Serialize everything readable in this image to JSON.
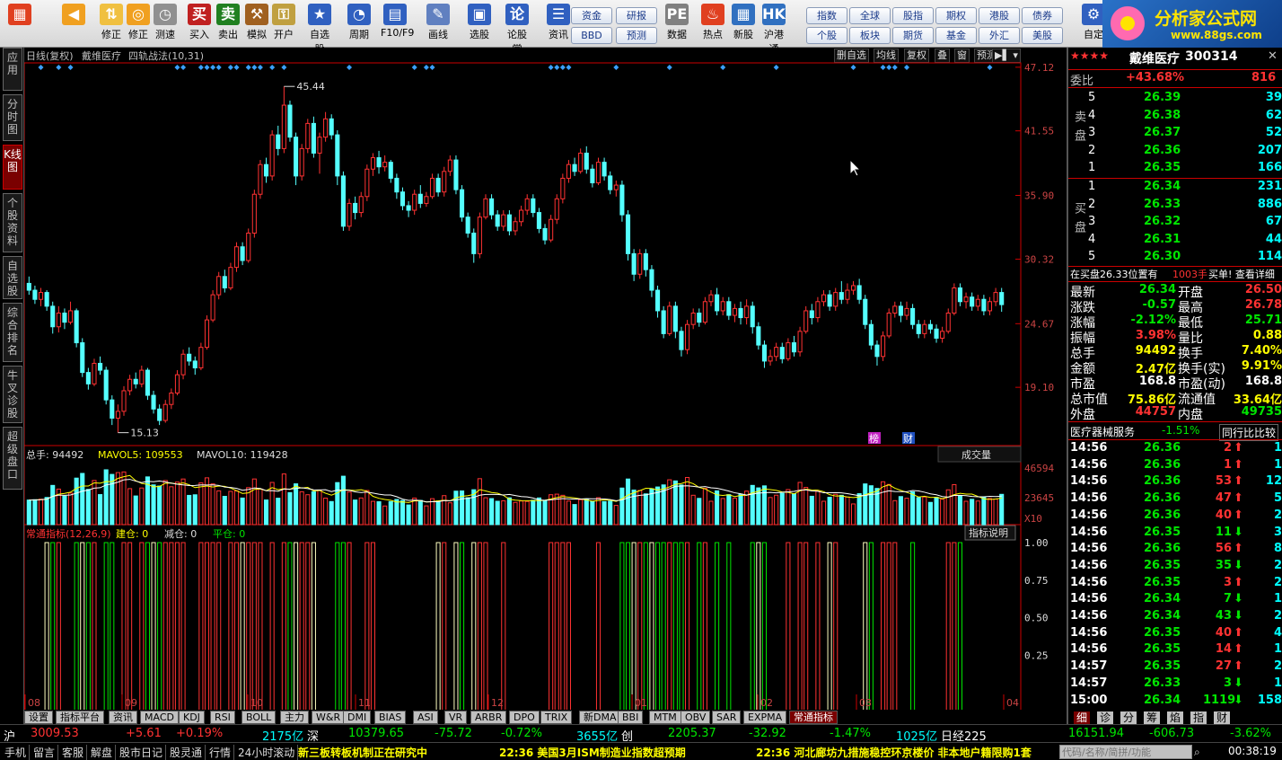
{
  "toolbar": {
    "buttons": [
      {
        "label": "",
        "icon": "grid-icon"
      },
      {
        "label": "",
        "icon": "back-arrow-icon"
      },
      {
        "label": "修正",
        "icon": "up-down-icon"
      },
      {
        "label": "修正",
        "icon": "refresh-icon"
      },
      {
        "label": "测速",
        "icon": "clock-icon"
      },
      {
        "label": "买入",
        "icon": "buy-icon"
      },
      {
        "label": "卖出",
        "icon": "sell-icon"
      },
      {
        "label": "模拟",
        "icon": "hammer-icon"
      },
      {
        "label": "开户",
        "icon": "lock-icon"
      },
      {
        "label": "自选股",
        "icon": "star-icon"
      },
      {
        "label": "周期",
        "icon": "period-icon"
      },
      {
        "label": "F10/F9",
        "icon": "f10-icon"
      },
      {
        "label": "画线",
        "icon": "pen-icon"
      },
      {
        "label": "选股",
        "icon": "select-icon"
      },
      {
        "label": "论股堂",
        "icon": "forum-icon"
      },
      {
        "label": "资讯",
        "icon": "news-icon"
      },
      {
        "label": "数据",
        "icon": "pe-icon"
      },
      {
        "label": "热点",
        "icon": "hot-icon"
      },
      {
        "label": "新股",
        "icon": "newstock-icon"
      },
      {
        "label": "沪港通",
        "icon": "hk-icon"
      },
      {
        "label": "自定",
        "icon": "custom-icon"
      }
    ],
    "small": [
      [
        "资金",
        "BBD"
      ],
      [
        "研报",
        "预测"
      ],
      [
        "指数",
        "个股"
      ],
      [
        "全球",
        "板块"
      ],
      [
        "股指",
        "期货"
      ],
      [
        "期权",
        "基金"
      ],
      [
        "港股",
        "外汇"
      ],
      [
        "债券",
        "美股"
      ]
    ],
    "logo_title": "分析家公式网",
    "logo_url": "www.88gs.com"
  },
  "left_tabs": [
    "应用",
    "分时图",
    "K线图",
    "个股资料",
    "自选股",
    "综合排名",
    "牛叉诊股",
    "超级盘口"
  ],
  "chart_header": {
    "title": "日线(复权)",
    "stock": "戴维医疗",
    "indicator": "四轨战法(10,31)",
    "tools": [
      "删自选",
      "均线",
      "复权",
      "叠",
      "窗",
      "预测"
    ]
  },
  "chart_data": {
    "type": "candlestick",
    "y_ticks": [
      "47.12",
      "41.55",
      "35.90",
      "30.32",
      "24.67",
      "19.10"
    ],
    "ylim": [
      14.0,
      47.5
    ],
    "x_ticks": [
      "08",
      "09",
      "10",
      "11",
      "12",
      "01",
      "02",
      "03",
      "04"
    ],
    "high_label": "45.44",
    "low_label": "15.13",
    "candles": [
      [
        28.2,
        27.6,
        28.8,
        27.2
      ],
      [
        27.6,
        26.8,
        28.0,
        26.4
      ],
      [
        26.8,
        27.4,
        27.8,
        26.2
      ],
      [
        27.4,
        26.2,
        27.6,
        25.8
      ],
      [
        26.2,
        24.4,
        26.6,
        23.8
      ],
      [
        24.4,
        25.6,
        26.2,
        23.9
      ],
      [
        25.6,
        24.8,
        26.0,
        24.2
      ],
      [
        24.8,
        25.8,
        26.6,
        24.6
      ],
      [
        25.8,
        23.0,
        26.0,
        22.6
      ],
      [
        23.0,
        20.4,
        23.4,
        20.0
      ],
      [
        20.4,
        19.4,
        20.8,
        18.9
      ],
      [
        19.4,
        21.2,
        21.6,
        19.2
      ],
      [
        21.2,
        20.6,
        21.8,
        20.2
      ],
      [
        20.6,
        18.0,
        20.9,
        17.6
      ],
      [
        18.0,
        16.4,
        18.4,
        15.8
      ],
      [
        16.4,
        17.0,
        17.6,
        15.13
      ],
      [
        17.0,
        18.8,
        19.2,
        16.6
      ],
      [
        18.8,
        19.8,
        20.2,
        18.4
      ],
      [
        19.8,
        19.4,
        20.4,
        19.0
      ],
      [
        19.4,
        20.6,
        21.0,
        19.1
      ],
      [
        20.6,
        18.4,
        20.8,
        18.0
      ],
      [
        18.4,
        17.2,
        18.8,
        16.8
      ],
      [
        17.2,
        16.2,
        17.6,
        15.8
      ],
      [
        16.2,
        17.6,
        18.0,
        16.0
      ],
      [
        17.6,
        18.6,
        19.0,
        17.2
      ],
      [
        18.6,
        20.2,
        20.6,
        18.4
      ],
      [
        20.2,
        22.0,
        22.4,
        19.8
      ],
      [
        22.0,
        21.4,
        22.6,
        21.0
      ],
      [
        21.4,
        20.8,
        21.8,
        20.2
      ],
      [
        20.8,
        22.6,
        23.0,
        20.6
      ],
      [
        22.6,
        25.0,
        25.4,
        22.4
      ],
      [
        25.0,
        27.2,
        27.6,
        24.8
      ],
      [
        27.2,
        28.8,
        29.2,
        26.8
      ],
      [
        28.8,
        27.8,
        29.4,
        27.4
      ],
      [
        27.8,
        29.6,
        30.0,
        27.6
      ],
      [
        29.6,
        31.4,
        31.8,
        29.2
      ],
      [
        31.4,
        30.2,
        31.8,
        29.8
      ],
      [
        30.2,
        32.6,
        33.0,
        30.0
      ],
      [
        32.6,
        36.0,
        36.4,
        32.2
      ],
      [
        36.0,
        38.6,
        39.0,
        35.6
      ],
      [
        38.6,
        37.6,
        39.2,
        37.0
      ],
      [
        37.6,
        41.2,
        41.6,
        37.2
      ],
      [
        41.2,
        40.0,
        42.0,
        39.4
      ],
      [
        40.0,
        43.8,
        45.44,
        39.6
      ],
      [
        43.8,
        41.0,
        44.2,
        40.6
      ],
      [
        41.0,
        37.6,
        41.4,
        36.8
      ],
      [
        37.6,
        40.0,
        40.4,
        37.2
      ],
      [
        40.0,
        42.2,
        42.6,
        39.6
      ],
      [
        42.2,
        39.6,
        42.8,
        39.2
      ],
      [
        39.6,
        41.0,
        41.4,
        37.8
      ],
      [
        41.0,
        42.6,
        43.2,
        40.6
      ],
      [
        42.6,
        41.2,
        43.0,
        40.8
      ],
      [
        41.2,
        37.6,
        41.6,
        36.8
      ],
      [
        37.6,
        33.2,
        38.0,
        32.8
      ],
      [
        33.2,
        35.2,
        35.6,
        32.8
      ],
      [
        35.2,
        34.4,
        35.8,
        33.8
      ],
      [
        34.4,
        35.8,
        36.2,
        34.0
      ],
      [
        35.8,
        38.2,
        38.6,
        35.4
      ],
      [
        38.2,
        39.2,
        39.6,
        37.6
      ],
      [
        39.2,
        38.4,
        39.8,
        37.8
      ],
      [
        38.4,
        38.8,
        39.4,
        38.0
      ],
      [
        38.8,
        37.4,
        39.0,
        37.0
      ],
      [
        37.4,
        36.2,
        37.8,
        35.6
      ],
      [
        36.2,
        35.0,
        36.6,
        34.6
      ],
      [
        35.0,
        34.6,
        35.4,
        34.0
      ],
      [
        34.6,
        36.0,
        36.4,
        34.2
      ],
      [
        36.0,
        35.2,
        36.8,
        34.8
      ],
      [
        35.2,
        35.8,
        36.2,
        34.9
      ],
      [
        35.8,
        37.4,
        37.8,
        35.6
      ],
      [
        37.4,
        36.2,
        37.8,
        35.8
      ],
      [
        36.2,
        38.0,
        38.4,
        35.8
      ],
      [
        38.0,
        39.0,
        39.4,
        37.6
      ],
      [
        39.0,
        36.4,
        39.4,
        36.0
      ],
      [
        36.4,
        34.0,
        36.8,
        33.6
      ],
      [
        34.0,
        32.6,
        34.4,
        32.2
      ],
      [
        32.6,
        30.8,
        33.0,
        30.0
      ],
      [
        30.8,
        34.0,
        34.4,
        30.4
      ],
      [
        34.0,
        35.6,
        36.0,
        33.8
      ],
      [
        35.6,
        34.2,
        36.0,
        33.8
      ],
      [
        34.2,
        33.2,
        34.6,
        32.8
      ],
      [
        33.2,
        34.2,
        34.6,
        32.8
      ],
      [
        34.2,
        32.8,
        34.6,
        32.4
      ],
      [
        32.8,
        33.6,
        34.0,
        32.4
      ],
      [
        33.6,
        34.6,
        35.0,
        33.2
      ],
      [
        34.6,
        35.6,
        36.0,
        34.2
      ],
      [
        35.6,
        34.4,
        36.0,
        34.0
      ],
      [
        34.4,
        33.0,
        34.8,
        32.6
      ],
      [
        33.0,
        32.0,
        33.4,
        31.6
      ],
      [
        32.0,
        33.8,
        34.2,
        31.8
      ],
      [
        33.8,
        35.6,
        36.0,
        33.4
      ],
      [
        35.6,
        37.4,
        37.8,
        35.2
      ],
      [
        37.4,
        38.6,
        39.0,
        37.0
      ],
      [
        38.6,
        38.0,
        39.2,
        37.6
      ],
      [
        38.0,
        39.6,
        40.0,
        37.8
      ],
      [
        39.6,
        38.2,
        40.2,
        37.8
      ],
      [
        38.2,
        37.0,
        38.6,
        36.6
      ],
      [
        37.0,
        38.8,
        39.2,
        36.8
      ],
      [
        38.8,
        37.6,
        39.2,
        37.2
      ],
      [
        37.6,
        36.4,
        38.0,
        36.0
      ],
      [
        36.4,
        36.8,
        37.2,
        35.8
      ],
      [
        36.8,
        34.2,
        37.2,
        33.6
      ],
      [
        34.2,
        30.8,
        34.6,
        30.2
      ],
      [
        30.8,
        29.0,
        31.2,
        28.4
      ],
      [
        29.0,
        30.8,
        31.2,
        28.6
      ],
      [
        30.8,
        29.4,
        31.2,
        28.8
      ],
      [
        29.4,
        27.6,
        29.8,
        27.0
      ],
      [
        27.6,
        25.8,
        28.0,
        25.2
      ],
      [
        25.8,
        23.8,
        26.2,
        23.4
      ],
      [
        23.8,
        26.2,
        26.6,
        23.6
      ],
      [
        26.2,
        24.0,
        26.6,
        23.4
      ],
      [
        24.0,
        22.4,
        24.4,
        21.8
      ],
      [
        22.4,
        24.6,
        25.0,
        22.0
      ],
      [
        24.6,
        25.6,
        26.0,
        24.2
      ],
      [
        25.6,
        24.8,
        26.0,
        24.4
      ],
      [
        24.8,
        26.6,
        27.0,
        24.6
      ],
      [
        26.6,
        27.2,
        27.6,
        26.2
      ],
      [
        27.2,
        25.8,
        27.8,
        25.4
      ],
      [
        25.8,
        26.6,
        27.0,
        25.4
      ],
      [
        26.6,
        25.4,
        27.0,
        25.0
      ],
      [
        25.4,
        26.0,
        26.4,
        24.8
      ],
      [
        26.0,
        25.2,
        26.6,
        24.6
      ],
      [
        25.2,
        26.2,
        26.8,
        24.6
      ],
      [
        26.2,
        24.4,
        26.6,
        23.8
      ],
      [
        24.4,
        22.8,
        24.8,
        22.4
      ],
      [
        22.8,
        21.4,
        23.2,
        20.8
      ],
      [
        21.4,
        21.8,
        22.4,
        21.0
      ],
      [
        21.8,
        22.6,
        23.0,
        21.4
      ],
      [
        22.6,
        21.6,
        23.0,
        21.2
      ],
      [
        21.6,
        23.0,
        23.4,
        21.4
      ],
      [
        23.0,
        22.2,
        23.6,
        21.8
      ],
      [
        22.2,
        24.0,
        24.4,
        21.8
      ],
      [
        24.0,
        25.8,
        26.2,
        23.8
      ],
      [
        25.8,
        25.2,
        26.4,
        24.6
      ],
      [
        25.2,
        26.6,
        27.0,
        24.8
      ],
      [
        26.6,
        27.2,
        27.6,
        26.2
      ],
      [
        27.2,
        26.2,
        27.6,
        25.8
      ],
      [
        26.2,
        27.4,
        27.8,
        25.8
      ],
      [
        27.4,
        26.8,
        28.4,
        26.4
      ],
      [
        26.8,
        27.6,
        28.2,
        26.4
      ],
      [
        27.6,
        28.0,
        28.4,
        27.2
      ],
      [
        28.0,
        26.8,
        28.6,
        26.4
      ],
      [
        26.8,
        24.6,
        27.2,
        24.2
      ],
      [
        24.6,
        22.8,
        25.0,
        22.4
      ],
      [
        22.8,
        21.8,
        23.2,
        21.0
      ],
      [
        21.8,
        23.6,
        24.0,
        21.4
      ],
      [
        23.6,
        25.6,
        26.0,
        23.4
      ],
      [
        25.6,
        26.2,
        26.6,
        25.2
      ],
      [
        26.2,
        25.4,
        26.6,
        24.8
      ],
      [
        25.4,
        26.0,
        26.6,
        25.0
      ],
      [
        26.0,
        24.6,
        26.4,
        24.2
      ],
      [
        24.6,
        23.8,
        25.0,
        23.4
      ],
      [
        23.8,
        24.6,
        25.0,
        23.4
      ],
      [
        24.6,
        24.2,
        25.0,
        23.8
      ],
      [
        24.2,
        23.4,
        24.6,
        23.0
      ],
      [
        23.4,
        24.0,
        24.4,
        23.0
      ],
      [
        24.0,
        25.6,
        26.0,
        23.8
      ],
      [
        25.6,
        27.8,
        28.2,
        25.4
      ],
      [
        27.8,
        26.6,
        28.2,
        26.2
      ],
      [
        26.6,
        27.0,
        27.4,
        26.0
      ],
      [
        27.0,
        26.2,
        27.4,
        25.8
      ],
      [
        26.2,
        26.8,
        27.2,
        25.8
      ],
      [
        26.8,
        25.8,
        27.2,
        25.4
      ],
      [
        25.8,
        26.6,
        27.0,
        25.4
      ],
      [
        26.6,
        27.4,
        27.8,
        26.2
      ],
      [
        27.4,
        26.34,
        27.8,
        25.71
      ]
    ],
    "volume_title": "总手: 94492",
    "mavol5": "MAVOL5: 109553",
    "mavol10": "MAVOL10: 119428",
    "volume_ticks": [
      "46594",
      "23645",
      "X10"
    ],
    "volume_ylim": [
      0,
      50000
    ],
    "volume_button": "成交量",
    "indicator_title": "常通指标(12,26,9)",
    "indicator_values": [
      "建仓: 0",
      "减仓: 0",
      "平仓: 0"
    ],
    "indicator_button": "指标说明",
    "indicator_ticks": [
      "1.00",
      "0.75",
      "0.50",
      "0.25"
    ],
    "indicator_ylim": [
      0,
      1.0
    ],
    "badges": [
      "榜",
      "财"
    ]
  },
  "right_panel": {
    "stars": "★★★★",
    "name": "戴维医疗",
    "code": "300314",
    "weibi_label": "委比",
    "weibi": "+43.68%",
    "weicha": "816",
    "sell_label": "卖盘",
    "buy_label": "买盘",
    "asks": [
      [
        "5",
        "26.39",
        "39"
      ],
      [
        "4",
        "26.38",
        "62"
      ],
      [
        "3",
        "26.37",
        "52"
      ],
      [
        "2",
        "26.36",
        "207"
      ],
      [
        "1",
        "26.35",
        "166"
      ]
    ],
    "bids": [
      [
        "1",
        "26.34",
        "231"
      ],
      [
        "2",
        "26.33",
        "886"
      ],
      [
        "3",
        "26.32",
        "67"
      ],
      [
        "4",
        "26.31",
        "44"
      ],
      [
        "5",
        "26.30",
        "114"
      ]
    ],
    "note_left": "在买盘26.33位置有",
    "note_qty": "1003手",
    "note_right": "买单! 查看详细",
    "stats": [
      [
        "最新",
        "26.34",
        "开盘",
        "26.50"
      ],
      [
        "涨跌",
        "-0.57",
        "最高",
        "26.78"
      ],
      [
        "涨幅",
        "-2.12%",
        "最低",
        "25.71"
      ],
      [
        "振幅",
        "3.98%",
        "量比",
        "0.88"
      ],
      [
        "总手",
        "94492",
        "换手",
        "7.40%"
      ],
      [
        "金额",
        "2.47亿",
        "换手(实)",
        "9.91%"
      ],
      [
        "市盈",
        "168.8",
        "市盈(动)",
        "168.8"
      ],
      [
        "总市值",
        "75.86亿",
        "流通值",
        "33.64亿"
      ],
      [
        "外盘",
        "44757",
        "内盘",
        "49735"
      ]
    ],
    "sector_name": "医疗器械服务",
    "sector_pct": "-1.51%",
    "sector_btn": "同行比比较",
    "ticks": [
      [
        "14:56",
        "26.36",
        "2",
        "up",
        "1"
      ],
      [
        "14:56",
        "26.36",
        "1",
        "up",
        "1"
      ],
      [
        "14:56",
        "26.36",
        "53",
        "up",
        "12"
      ],
      [
        "14:56",
        "26.36",
        "47",
        "up",
        "5"
      ],
      [
        "14:56",
        "26.36",
        "40",
        "up",
        "2"
      ],
      [
        "14:56",
        "26.35",
        "11",
        "down",
        "3"
      ],
      [
        "14:56",
        "26.36",
        "56",
        "up",
        "8"
      ],
      [
        "14:56",
        "26.35",
        "35",
        "down",
        "2"
      ],
      [
        "14:56",
        "26.35",
        "3",
        "up",
        "2"
      ],
      [
        "14:56",
        "26.34",
        "7",
        "down",
        "1"
      ],
      [
        "14:56",
        "26.34",
        "43",
        "down",
        "2"
      ],
      [
        "14:56",
        "26.35",
        "40",
        "up",
        "4"
      ],
      [
        "14:56",
        "26.35",
        "14",
        "up",
        "1"
      ],
      [
        "14:57",
        "26.35",
        "27",
        "up",
        "2"
      ],
      [
        "14:57",
        "26.33",
        "3",
        "down",
        "1"
      ],
      [
        "15:00",
        "26.34",
        "1119",
        "down",
        "158"
      ]
    ],
    "bottom_tabs": [
      "细",
      "诊",
      "分",
      "筹",
      "焰",
      "指",
      "财"
    ]
  },
  "bottom_tabs": [
    "设置",
    "指标平台",
    "资讯",
    "MACD",
    "KDJ",
    "RSI",
    "BOLL",
    "主力",
    "W&R",
    "DMI",
    "BIAS",
    "ASI",
    "VR",
    "ARBR",
    "DPO",
    "TRIX",
    "新DMA",
    "BBI",
    "MTM",
    "OBV",
    "SAR",
    "EXPMA",
    "常通指标"
  ],
  "status1": {
    "sh_label": "沪",
    "sh_idx": "3009.53",
    "sh_chg": "+5.61",
    "sh_pct": "+0.19%",
    "sh_amt": "2175亿",
    "sz_label": "深",
    "sz_idx": "10379.65",
    "sz_chg": "-75.72",
    "sz_pct": "-0.72%",
    "sz_amt": "3655亿",
    "cy_label": "创",
    "cy_idx": "2205.37",
    "cy_chg": "-32.92",
    "cy_pct": "-1.47%",
    "cy_amt": "1025亿",
    "nk_label": "日经225",
    "nk_idx": "16151.94",
    "nk_chg": "-606.73",
    "nk_pct": "-3.62%"
  },
  "status2": {
    "links": [
      "手机",
      "留言",
      "客服",
      "解盘",
      "股市日记",
      "股灵通",
      "行情",
      "24小时滚动"
    ],
    "news1": "新三板转板机制正在研究中",
    "news2": "22:36 美国3月ISM制造业指数超预期",
    "news3": "22:36 河北廊坊九措施稳控环京楼价 非本地户籍限购1套",
    "search_placeholder": "代码/名称/简拼/功能",
    "clock": "00:38:19"
  }
}
